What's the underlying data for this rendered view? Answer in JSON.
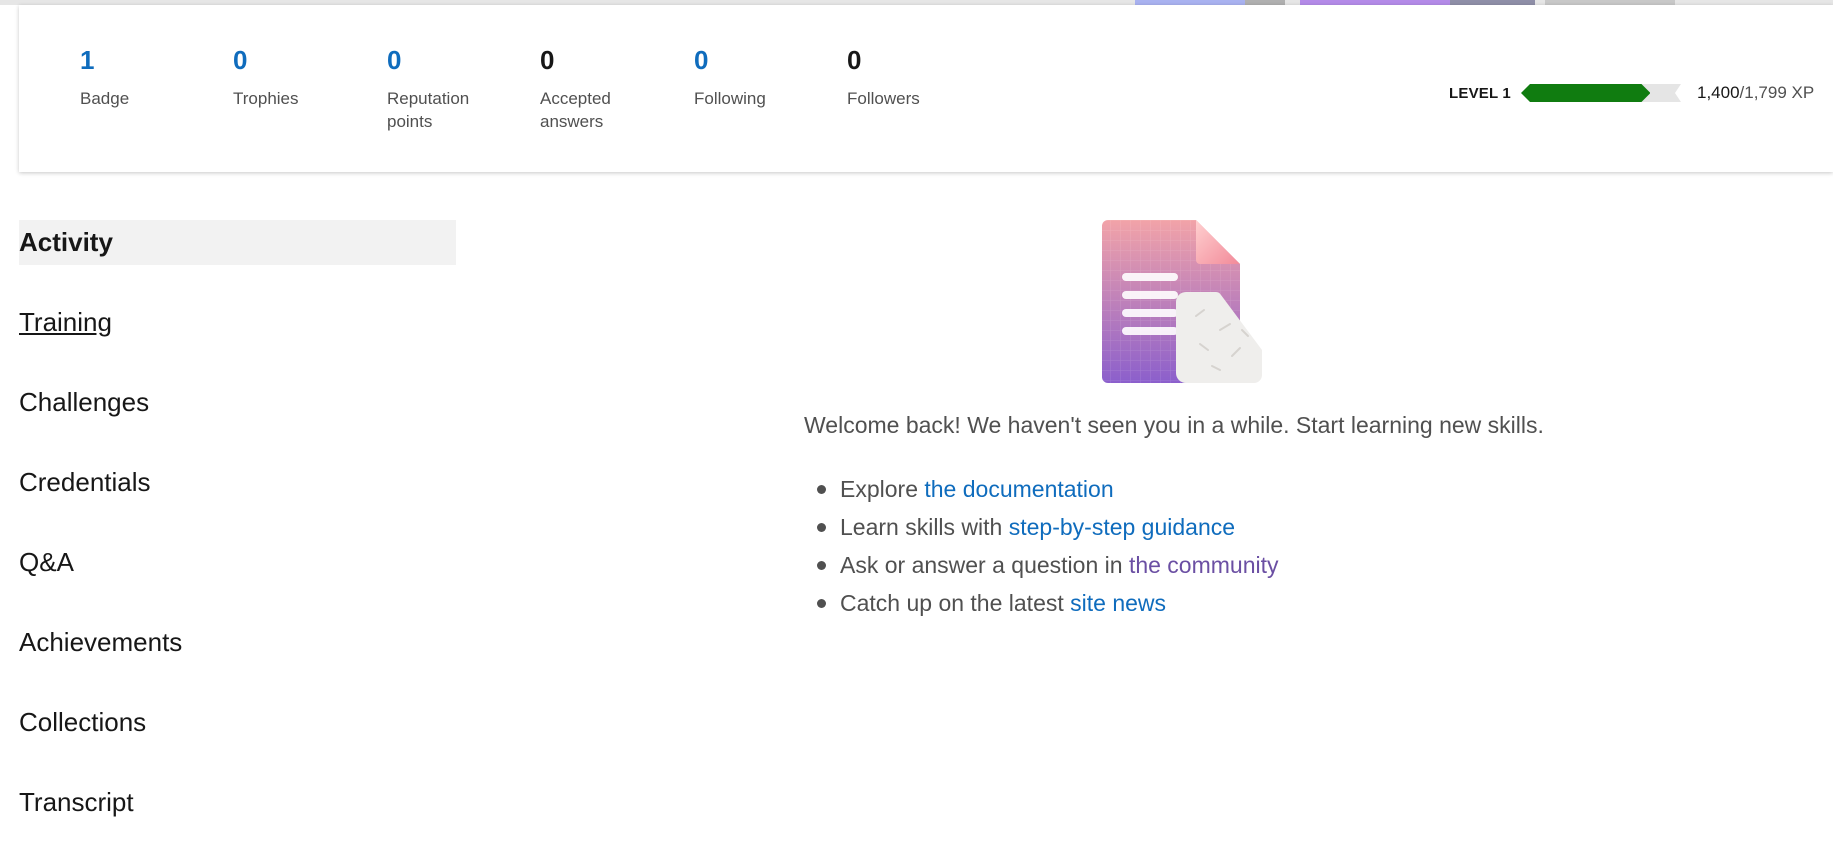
{
  "colors": {
    "accent": "#0f6cbd",
    "progress": "#107c10",
    "visited_link": "#6b4fa3"
  },
  "stats": [
    {
      "value": "1",
      "label": "Badge"
    },
    {
      "value": "0",
      "label": "Trophies"
    },
    {
      "value": "0",
      "label": "Reputation points"
    },
    {
      "value": "0",
      "label": "Accepted answers"
    },
    {
      "value": "0",
      "label": "Following"
    },
    {
      "value": "0",
      "label": "Followers"
    }
  ],
  "level": {
    "label": "LEVEL 1",
    "xp_current": "1,400",
    "xp_total": "/1,799 XP",
    "progress_fraction": 0.78
  },
  "sidebar": {
    "items": [
      {
        "label": "Activity"
      },
      {
        "label": "Training"
      },
      {
        "label": "Challenges"
      },
      {
        "label": "Credentials"
      },
      {
        "label": "Q&A"
      },
      {
        "label": "Achievements"
      },
      {
        "label": "Collections"
      },
      {
        "label": "Transcript"
      }
    ]
  },
  "main": {
    "illustration_icon": "document-illustration-icon",
    "welcome": "Welcome back! We haven't seen you in a while. Start learning new skills.",
    "tips": [
      {
        "prefix": "Explore ",
        "link": "the documentation"
      },
      {
        "prefix": "Learn skills with ",
        "link": "step-by-step guidance"
      },
      {
        "prefix": "Ask or answer a question in ",
        "link": "the community"
      },
      {
        "prefix": "Catch up on the latest ",
        "link": "site news"
      }
    ]
  }
}
